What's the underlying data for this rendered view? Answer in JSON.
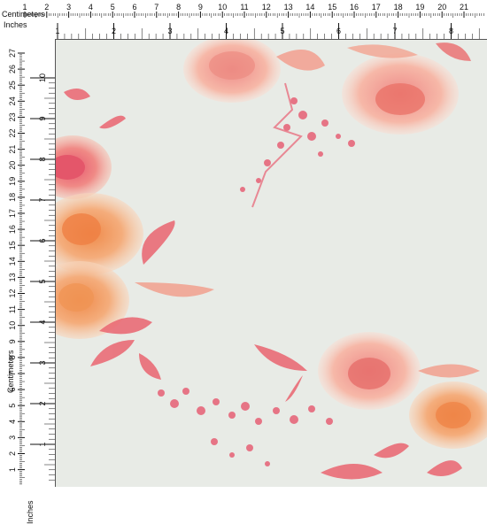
{
  "ruler": {
    "cm_label": "Centimeters",
    "inch_label": "Inches",
    "cm_side_label": "Centimeters",
    "inch_side_label": "Inches",
    "top_cm": [
      "1",
      "2",
      "3",
      "4",
      "5",
      "6",
      "7",
      "8",
      "9",
      "10",
      "11",
      "12",
      "13",
      "14",
      "15",
      "16",
      "17",
      "18",
      "19",
      "20",
      "21"
    ],
    "top_in": [
      "1",
      "2",
      "3",
      "4",
      "5",
      "6",
      "7",
      "8"
    ],
    "side_cm": [
      "27",
      "26",
      "25",
      "24",
      "23",
      "22",
      "21",
      "20",
      "19",
      "18",
      "17",
      "16",
      "15",
      "14",
      "13",
      "12",
      "11",
      "10",
      "9",
      "8",
      "7",
      "6",
      "5",
      "4",
      "3",
      "2",
      "1"
    ],
    "side_in": [
      "10",
      "9",
      "8",
      "7",
      "6",
      "5",
      "4",
      "3",
      "2",
      "1"
    ]
  },
  "colors": {
    "fabric": "#e8ebe6",
    "coral": "#e8606a",
    "salmon": "#f2a08e",
    "peach": "#f3a36a",
    "pink": "#e6576e"
  }
}
